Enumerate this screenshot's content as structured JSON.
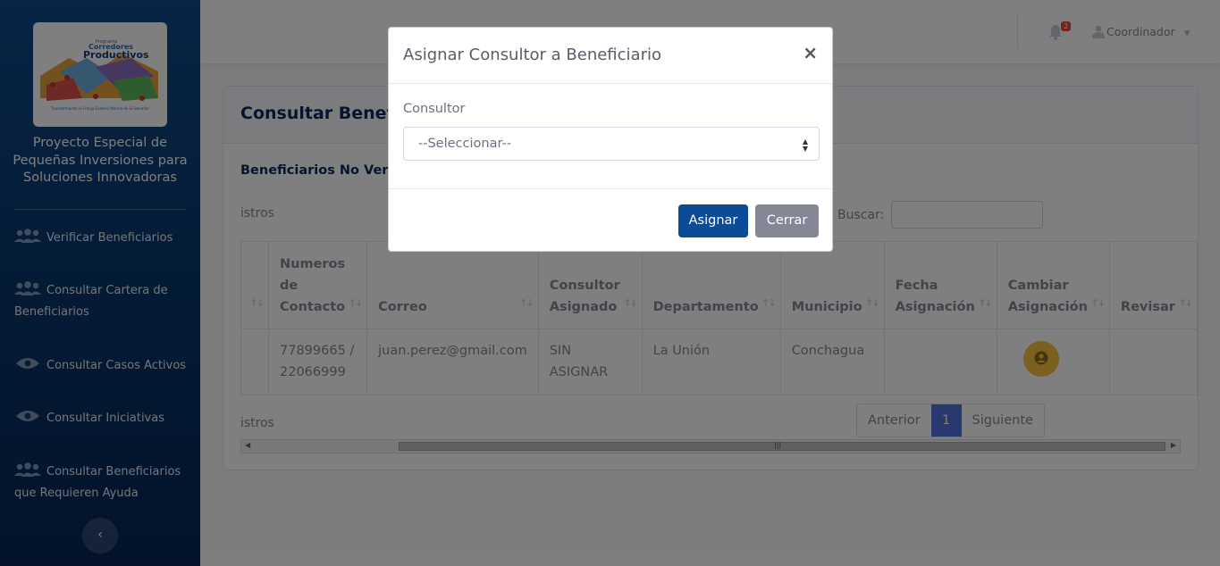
{
  "sidebar": {
    "brand": "Proyecto Especial de Pequeñas Inversiones para Soluciones Innovadoras",
    "logo": {
      "small": "Programa",
      "title1": "Corredores",
      "title2": "Productivos",
      "tagline": "Transformando la Franja Costero-Marina de El Salvador"
    },
    "items": [
      {
        "label": "Verificar Beneficiarios",
        "icon": "users-icon"
      },
      {
        "label": "Consultar Cartera de Beneficiarios",
        "icon": "users-icon"
      },
      {
        "label": "Consultar Casos Activos",
        "icon": "eye-icon"
      },
      {
        "label": "Consultar Iniciativas",
        "icon": "eye-icon"
      },
      {
        "label": "Consultar Beneficiarios que Requieren Ayuda",
        "icon": "users-icon"
      }
    ],
    "toggle": "‹"
  },
  "topbar": {
    "notification_count": "2",
    "user": "Coordinador"
  },
  "page": {
    "title": "Consultar Benefic",
    "subtitle": "Beneficiarios No Verif",
    "records_top": "istros",
    "records_bottom": "istros",
    "search_label": "Buscar:",
    "table": {
      "headers": [
        "",
        "Numeros de Contacto",
        "Correo",
        "Consultor Asignado",
        "Departamento",
        "Municipio",
        "Fecha Asignación",
        "Cambiar Asignación",
        "Revisar"
      ],
      "rows": [
        {
          "contacto": "77899665 / 22066999",
          "correo": "juan.perez@gmail.com",
          "consultor": "SIN ASIGNAR",
          "departamento": "La Unión",
          "municipio": "Conchagua",
          "fecha": "",
          "revisar": ""
        }
      ]
    },
    "pagination": {
      "prev": "Anterior",
      "current": "1",
      "next": "Siguiente"
    }
  },
  "modal": {
    "title": "Asignar Consultor a Beneficiario",
    "close": "×",
    "field_label": "Consultor",
    "select_value": "--Seleccionar--",
    "assign_button": "Asignar",
    "close_button": "Cerrar"
  },
  "colors": {
    "primary": "#0b4c98",
    "secondary": "#858796",
    "warning": "#f6c23e",
    "pagination_active": "#4e73df",
    "badge": "#e74a3b"
  }
}
